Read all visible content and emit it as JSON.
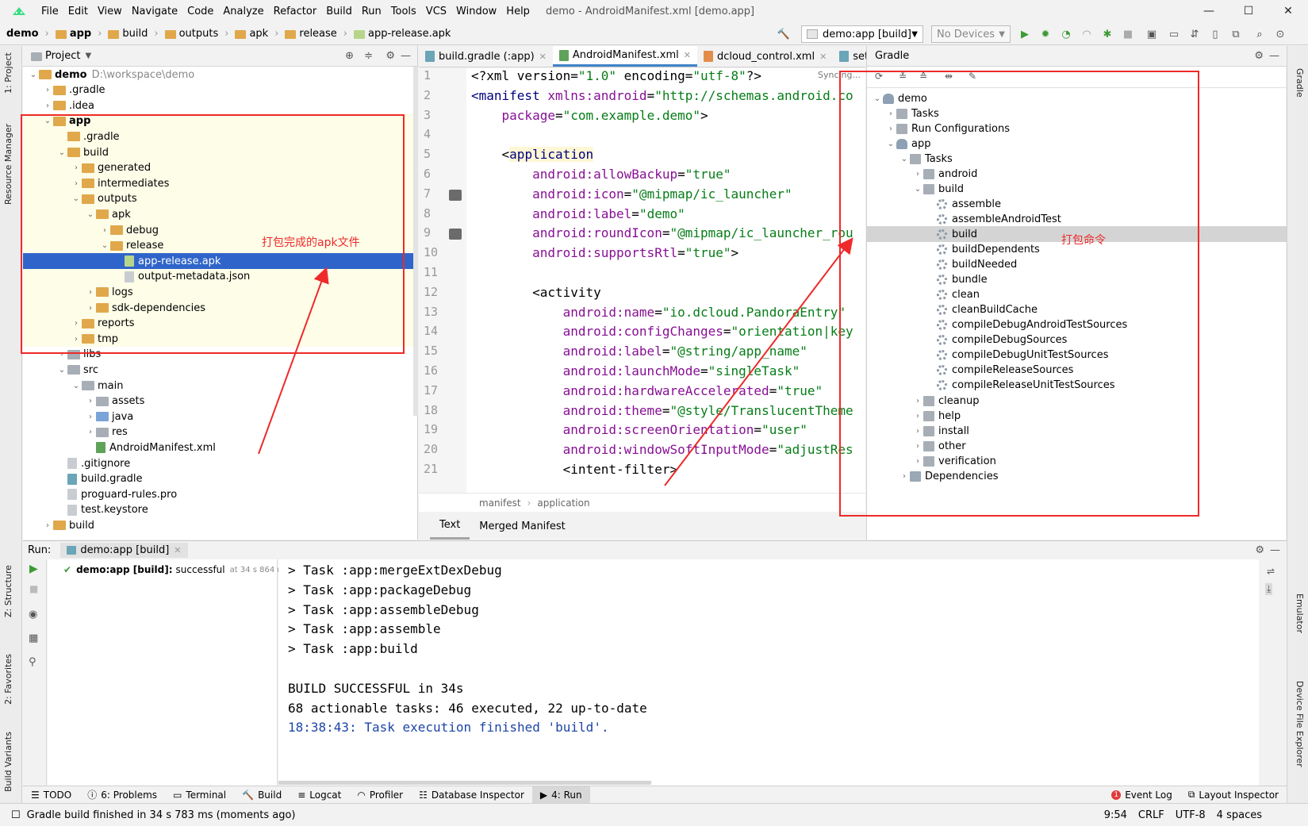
{
  "menubar": {
    "items": [
      "File",
      "Edit",
      "View",
      "Navigate",
      "Code",
      "Analyze",
      "Refactor",
      "Build",
      "Run",
      "Tools",
      "VCS",
      "Window",
      "Help"
    ],
    "window_title": "demo - AndroidManifest.xml [demo.app]"
  },
  "navbar": {
    "crumbs": [
      "demo",
      "app",
      "build",
      "outputs",
      "apk",
      "release",
      "app-release.apk"
    ],
    "run_config": "demo:app [build]",
    "devices": "No Devices"
  },
  "left_stripe": {
    "tabs": [
      "1: Project",
      "Resource Manager",
      "Z: Structure",
      "2: Favorites",
      "Build Variants"
    ]
  },
  "right_stripe": {
    "tabs": [
      "Gradle",
      "Emulator",
      "Device File Explorer"
    ]
  },
  "project": {
    "title": "Project",
    "tree": [
      {
        "label": "demo",
        "extra": "D:\\workspace\\demo",
        "depth": 0,
        "icon": "folder",
        "bold": true,
        "expanded": true
      },
      {
        "label": ".gradle",
        "depth": 1,
        "icon": "folder",
        "expanded": false
      },
      {
        "label": ".idea",
        "depth": 1,
        "icon": "folder",
        "expanded": false
      },
      {
        "label": "app",
        "depth": 1,
        "icon": "folder",
        "bold": true,
        "expanded": true
      },
      {
        "label": ".gradle",
        "depth": 2,
        "icon": "folder",
        "leaf": true
      },
      {
        "label": "build",
        "depth": 2,
        "icon": "folder",
        "expanded": true
      },
      {
        "label": "generated",
        "depth": 3,
        "icon": "folder",
        "expanded": false
      },
      {
        "label": "intermediates",
        "depth": 3,
        "icon": "folder",
        "expanded": false
      },
      {
        "label": "outputs",
        "depth": 3,
        "icon": "folder",
        "expanded": true
      },
      {
        "label": "apk",
        "depth": 4,
        "icon": "folder",
        "expanded": true
      },
      {
        "label": "debug",
        "depth": 5,
        "icon": "folder",
        "expanded": false
      },
      {
        "label": "release",
        "depth": 5,
        "icon": "folder",
        "expanded": true
      },
      {
        "label": "app-release.apk",
        "depth": 6,
        "icon": "apk",
        "leaf": true,
        "selected": true
      },
      {
        "label": "output-metadata.json",
        "depth": 6,
        "icon": "file",
        "leaf": true
      },
      {
        "label": "logs",
        "depth": 4,
        "icon": "folder",
        "expanded": false
      },
      {
        "label": "sdk-dependencies",
        "depth": 4,
        "icon": "folder",
        "expanded": false
      },
      {
        "label": "reports",
        "depth": 3,
        "icon": "folder",
        "expanded": false
      },
      {
        "label": "tmp",
        "depth": 3,
        "icon": "folder",
        "expanded": false
      },
      {
        "label": "libs",
        "depth": 2,
        "icon": "grey",
        "expanded": false
      },
      {
        "label": "src",
        "depth": 2,
        "icon": "grey",
        "expanded": true
      },
      {
        "label": "main",
        "depth": 3,
        "icon": "grey",
        "expanded": true
      },
      {
        "label": "assets",
        "depth": 4,
        "icon": "grey",
        "expanded": false
      },
      {
        "label": "java",
        "depth": 4,
        "icon": "blue",
        "expanded": false
      },
      {
        "label": "res",
        "depth": 4,
        "icon": "grey",
        "expanded": false
      },
      {
        "label": "AndroidManifest.xml",
        "depth": 4,
        "icon": "mf",
        "leaf": true
      },
      {
        "label": ".gitignore",
        "depth": 2,
        "icon": "file",
        "leaf": true
      },
      {
        "label": "build.gradle",
        "depth": 2,
        "icon": "gradle",
        "leaf": true
      },
      {
        "label": "proguard-rules.pro",
        "depth": 2,
        "icon": "file",
        "leaf": true
      },
      {
        "label": "test.keystore",
        "depth": 2,
        "icon": "file",
        "leaf": true
      },
      {
        "label": "build",
        "depth": 1,
        "icon": "folder",
        "expanded": false
      }
    ]
  },
  "editor": {
    "tabs": [
      {
        "label": "build.gradle (:app)",
        "active": false
      },
      {
        "label": "AndroidManifest.xml",
        "active": true
      },
      {
        "label": "dcloud_control.xml",
        "active": false
      },
      {
        "label": "setti",
        "active": false
      }
    ],
    "syncing": "Syncing...",
    "lines": [
      {
        "no": "1",
        "parts": [
          [
            "t",
            "<?xml version="
          ],
          [
            "s",
            "\"1.0\""
          ],
          [
            "t",
            " encoding="
          ],
          [
            "s",
            "\"utf-8\""
          ],
          [
            "t",
            "?>"
          ]
        ]
      },
      {
        "no": "2",
        "parts": [
          [
            "g",
            "<manifest "
          ],
          [
            "a",
            "xmlns:android"
          ],
          [
            "t",
            "="
          ],
          [
            "s",
            "\"http://schemas.android.co"
          ]
        ]
      },
      {
        "no": "3",
        "parts": [
          [
            "t",
            "    "
          ],
          [
            "a",
            "package"
          ],
          [
            "t",
            "="
          ],
          [
            "s",
            "\"com.example.demo\""
          ],
          [
            "t",
            ">"
          ]
        ]
      },
      {
        "no": "4",
        "parts": []
      },
      {
        "no": "5",
        "parts": [
          [
            "t",
            "    <"
          ],
          [
            "h",
            "application"
          ]
        ]
      },
      {
        "no": "6",
        "parts": [
          [
            "t",
            "        "
          ],
          [
            "a",
            "android:allowBackup"
          ],
          [
            "t",
            "="
          ],
          [
            "s",
            "\"true\""
          ]
        ]
      },
      {
        "no": "7",
        "parts": [
          [
            "t",
            "        "
          ],
          [
            "a",
            "android:icon"
          ],
          [
            "t",
            "="
          ],
          [
            "s",
            "\"@mipmap/ic_launcher\""
          ]
        ]
      },
      {
        "no": "8",
        "parts": [
          [
            "t",
            "        "
          ],
          [
            "a",
            "android:label"
          ],
          [
            "t",
            "="
          ],
          [
            "s",
            "\"demo\""
          ]
        ]
      },
      {
        "no": "9",
        "parts": [
          [
            "t",
            "        "
          ],
          [
            "a",
            "android:roundIcon"
          ],
          [
            "t",
            "="
          ],
          [
            "s",
            "\"@mipmap/ic_launcher_rou"
          ]
        ]
      },
      {
        "no": "10",
        "parts": [
          [
            "t",
            "        "
          ],
          [
            "a",
            "android:supportsRtl"
          ],
          [
            "t",
            "="
          ],
          [
            "s",
            "\"true\""
          ],
          [
            "t",
            ">"
          ]
        ]
      },
      {
        "no": "11",
        "parts": []
      },
      {
        "no": "12",
        "parts": [
          [
            "t",
            "        <activity"
          ]
        ]
      },
      {
        "no": "13",
        "parts": [
          [
            "t",
            "            "
          ],
          [
            "a",
            "android:name"
          ],
          [
            "t",
            "="
          ],
          [
            "s",
            "\"io.dcloud.PandoraEntry\""
          ]
        ]
      },
      {
        "no": "14",
        "parts": [
          [
            "t",
            "            "
          ],
          [
            "a",
            "android:configChanges"
          ],
          [
            "t",
            "="
          ],
          [
            "s",
            "\"orientation|key"
          ]
        ]
      },
      {
        "no": "15",
        "parts": [
          [
            "t",
            "            "
          ],
          [
            "a",
            "android:label"
          ],
          [
            "t",
            "="
          ],
          [
            "s",
            "\"@string/app_name\""
          ]
        ]
      },
      {
        "no": "16",
        "parts": [
          [
            "t",
            "            "
          ],
          [
            "a",
            "android:launchMode"
          ],
          [
            "t",
            "="
          ],
          [
            "s",
            "\"singleTask\""
          ]
        ]
      },
      {
        "no": "17",
        "parts": [
          [
            "t",
            "            "
          ],
          [
            "a",
            "android:hardwareAccelerated"
          ],
          [
            "t",
            "="
          ],
          [
            "s",
            "\"true\""
          ]
        ]
      },
      {
        "no": "18",
        "parts": [
          [
            "t",
            "            "
          ],
          [
            "a",
            "android:theme"
          ],
          [
            "t",
            "="
          ],
          [
            "s",
            "\"@style/TranslucentTheme"
          ]
        ]
      },
      {
        "no": "19",
        "parts": [
          [
            "t",
            "            "
          ],
          [
            "a",
            "android:screenOrientation"
          ],
          [
            "t",
            "="
          ],
          [
            "s",
            "\"user\""
          ]
        ]
      },
      {
        "no": "20",
        "parts": [
          [
            "t",
            "            "
          ],
          [
            "a",
            "android:windowSoftInputMode"
          ],
          [
            "t",
            "="
          ],
          [
            "s",
            "\"adjustRes"
          ]
        ]
      },
      {
        "no": "21",
        "parts": [
          [
            "t",
            "            <intent-filter>"
          ]
        ]
      }
    ],
    "breadcrumb": [
      "manifest",
      "application"
    ],
    "bottom_tabs": [
      {
        "label": "Text",
        "active": true
      },
      {
        "label": "Merged Manifest",
        "active": false
      }
    ]
  },
  "gradle": {
    "title": "Gradle",
    "tree": [
      {
        "label": "demo",
        "depth": 0,
        "icon": "elephant",
        "expanded": true
      },
      {
        "label": "Tasks",
        "depth": 1,
        "icon": "tasks",
        "expanded": false
      },
      {
        "label": "Run Configurations",
        "depth": 1,
        "icon": "tasks",
        "expanded": false
      },
      {
        "label": "app",
        "depth": 1,
        "icon": "elephant",
        "expanded": true
      },
      {
        "label": "Tasks",
        "depth": 2,
        "icon": "tasks",
        "expanded": true
      },
      {
        "label": "android",
        "depth": 3,
        "icon": "tasks",
        "expanded": false
      },
      {
        "label": "build",
        "depth": 3,
        "icon": "tasks",
        "expanded": true
      },
      {
        "label": "assemble",
        "depth": 4,
        "icon": "gear",
        "leaf": true
      },
      {
        "label": "assembleAndroidTest",
        "depth": 4,
        "icon": "gear",
        "leaf": true
      },
      {
        "label": "build",
        "depth": 4,
        "icon": "gear",
        "leaf": true,
        "selected": true
      },
      {
        "label": "buildDependents",
        "depth": 4,
        "icon": "gear",
        "leaf": true
      },
      {
        "label": "buildNeeded",
        "depth": 4,
        "icon": "gear",
        "leaf": true
      },
      {
        "label": "bundle",
        "depth": 4,
        "icon": "gear",
        "leaf": true
      },
      {
        "label": "clean",
        "depth": 4,
        "icon": "gear",
        "leaf": true
      },
      {
        "label": "cleanBuildCache",
        "depth": 4,
        "icon": "gear",
        "leaf": true
      },
      {
        "label": "compileDebugAndroidTestSources",
        "depth": 4,
        "icon": "gear",
        "leaf": true
      },
      {
        "label": "compileDebugSources",
        "depth": 4,
        "icon": "gear",
        "leaf": true
      },
      {
        "label": "compileDebugUnitTestSources",
        "depth": 4,
        "icon": "gear",
        "leaf": true
      },
      {
        "label": "compileReleaseSources",
        "depth": 4,
        "icon": "gear",
        "leaf": true
      },
      {
        "label": "compileReleaseUnitTestSources",
        "depth": 4,
        "icon": "gear",
        "leaf": true
      },
      {
        "label": "cleanup",
        "depth": 3,
        "icon": "tasks",
        "expanded": false
      },
      {
        "label": "help",
        "depth": 3,
        "icon": "tasks",
        "expanded": false
      },
      {
        "label": "install",
        "depth": 3,
        "icon": "tasks",
        "expanded": false
      },
      {
        "label": "other",
        "depth": 3,
        "icon": "tasks",
        "expanded": false
      },
      {
        "label": "verification",
        "depth": 3,
        "icon": "tasks",
        "expanded": false
      },
      {
        "label": "Dependencies",
        "depth": 2,
        "icon": "deps",
        "expanded": false
      }
    ]
  },
  "run": {
    "label": "Run:",
    "tab": "demo:app [build]",
    "tree_item": "demo:app [build]:",
    "tree_status": "successful",
    "tree_time": "at 34 s 864 ms",
    "console": [
      {
        "text": "> Task :app:mergeExtDexDebug",
        "kind": "normal"
      },
      {
        "text": "> Task :app:packageDebug",
        "kind": "normal"
      },
      {
        "text": "> Task :app:assembleDebug",
        "kind": "normal"
      },
      {
        "text": "> Task :app:assemble",
        "kind": "normal"
      },
      {
        "text": "> Task :app:build",
        "kind": "normal"
      },
      {
        "text": "",
        "kind": "normal"
      },
      {
        "text": "BUILD SUCCESSFUL in 34s",
        "kind": "normal"
      },
      {
        "text": "68 actionable tasks: 46 executed, 22 up-to-date",
        "kind": "normal"
      },
      {
        "text": "18:38:43: Task execution finished 'build'.",
        "kind": "info"
      }
    ]
  },
  "bottom_tabs": [
    {
      "label": "TODO",
      "active": false
    },
    {
      "label": "6: Problems",
      "active": false
    },
    {
      "label": "Terminal",
      "active": false
    },
    {
      "label": "Build",
      "active": false
    },
    {
      "label": "Logcat",
      "active": false
    },
    {
      "label": "Profiler",
      "active": false
    },
    {
      "label": "Database Inspector",
      "active": false
    },
    {
      "label": "4: Run",
      "active": true
    }
  ],
  "bottom_right_tabs": [
    {
      "label": "Event Log"
    },
    {
      "label": "Layout Inspector"
    }
  ],
  "statusbar": {
    "message": "Gradle build finished in 34 s 783 ms (moments ago)",
    "position": "9:54",
    "line_sep": "CRLF",
    "encoding": "UTF-8",
    "indent": "4 spaces"
  },
  "annotations": {
    "apk_note": "打包完成的apk文件",
    "build_note": "打包命令"
  },
  "colors": {
    "selection": "#2f65ca",
    "annotation_red": "#ee2a2a",
    "xml_string": "#067d17",
    "xml_attr": "#871094",
    "run_green": "#3d9b35"
  }
}
